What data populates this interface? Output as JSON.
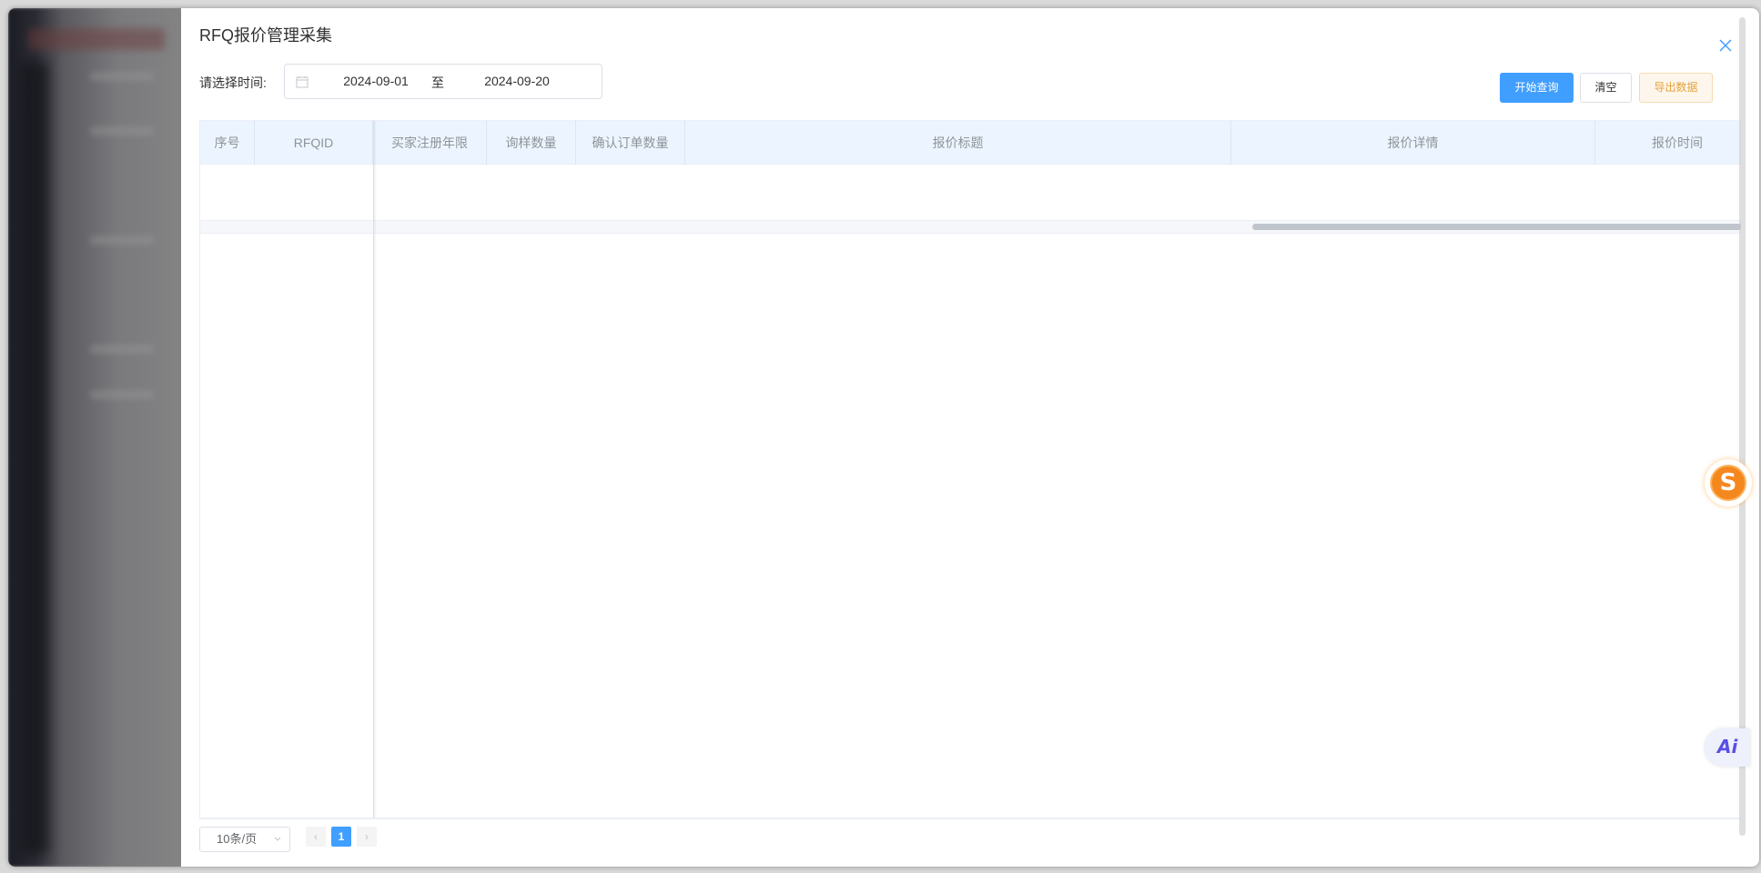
{
  "dialog": {
    "title": "RFQ报价管理采集"
  },
  "filter": {
    "label": "请选择时间:",
    "start_date": "2024-09-01",
    "separator": "至",
    "end_date": "2024-09-20"
  },
  "actions": {
    "query_label": "开始查询",
    "clear_label": "清空",
    "export_label": "导出数据"
  },
  "table": {
    "columns": [
      "序号",
      "RFQID",
      "买家注册年限",
      "询样数量",
      "确认订单数量",
      "报价标题",
      "报价详情",
      "报价时间"
    ],
    "rows": []
  },
  "pagination": {
    "page_size": "10条/页",
    "current_page": "1",
    "prev": "‹",
    "next": "›"
  },
  "floating": {
    "s_badge": "S",
    "ai_badge": "Ai"
  },
  "colors": {
    "primary": "#409eff",
    "warning": "#e6a23c",
    "header_bg": "#ecf5ff"
  },
  "icons": {
    "close": "close-icon",
    "calendar": "calendar-icon",
    "chevron": "chevron-down-icon"
  }
}
